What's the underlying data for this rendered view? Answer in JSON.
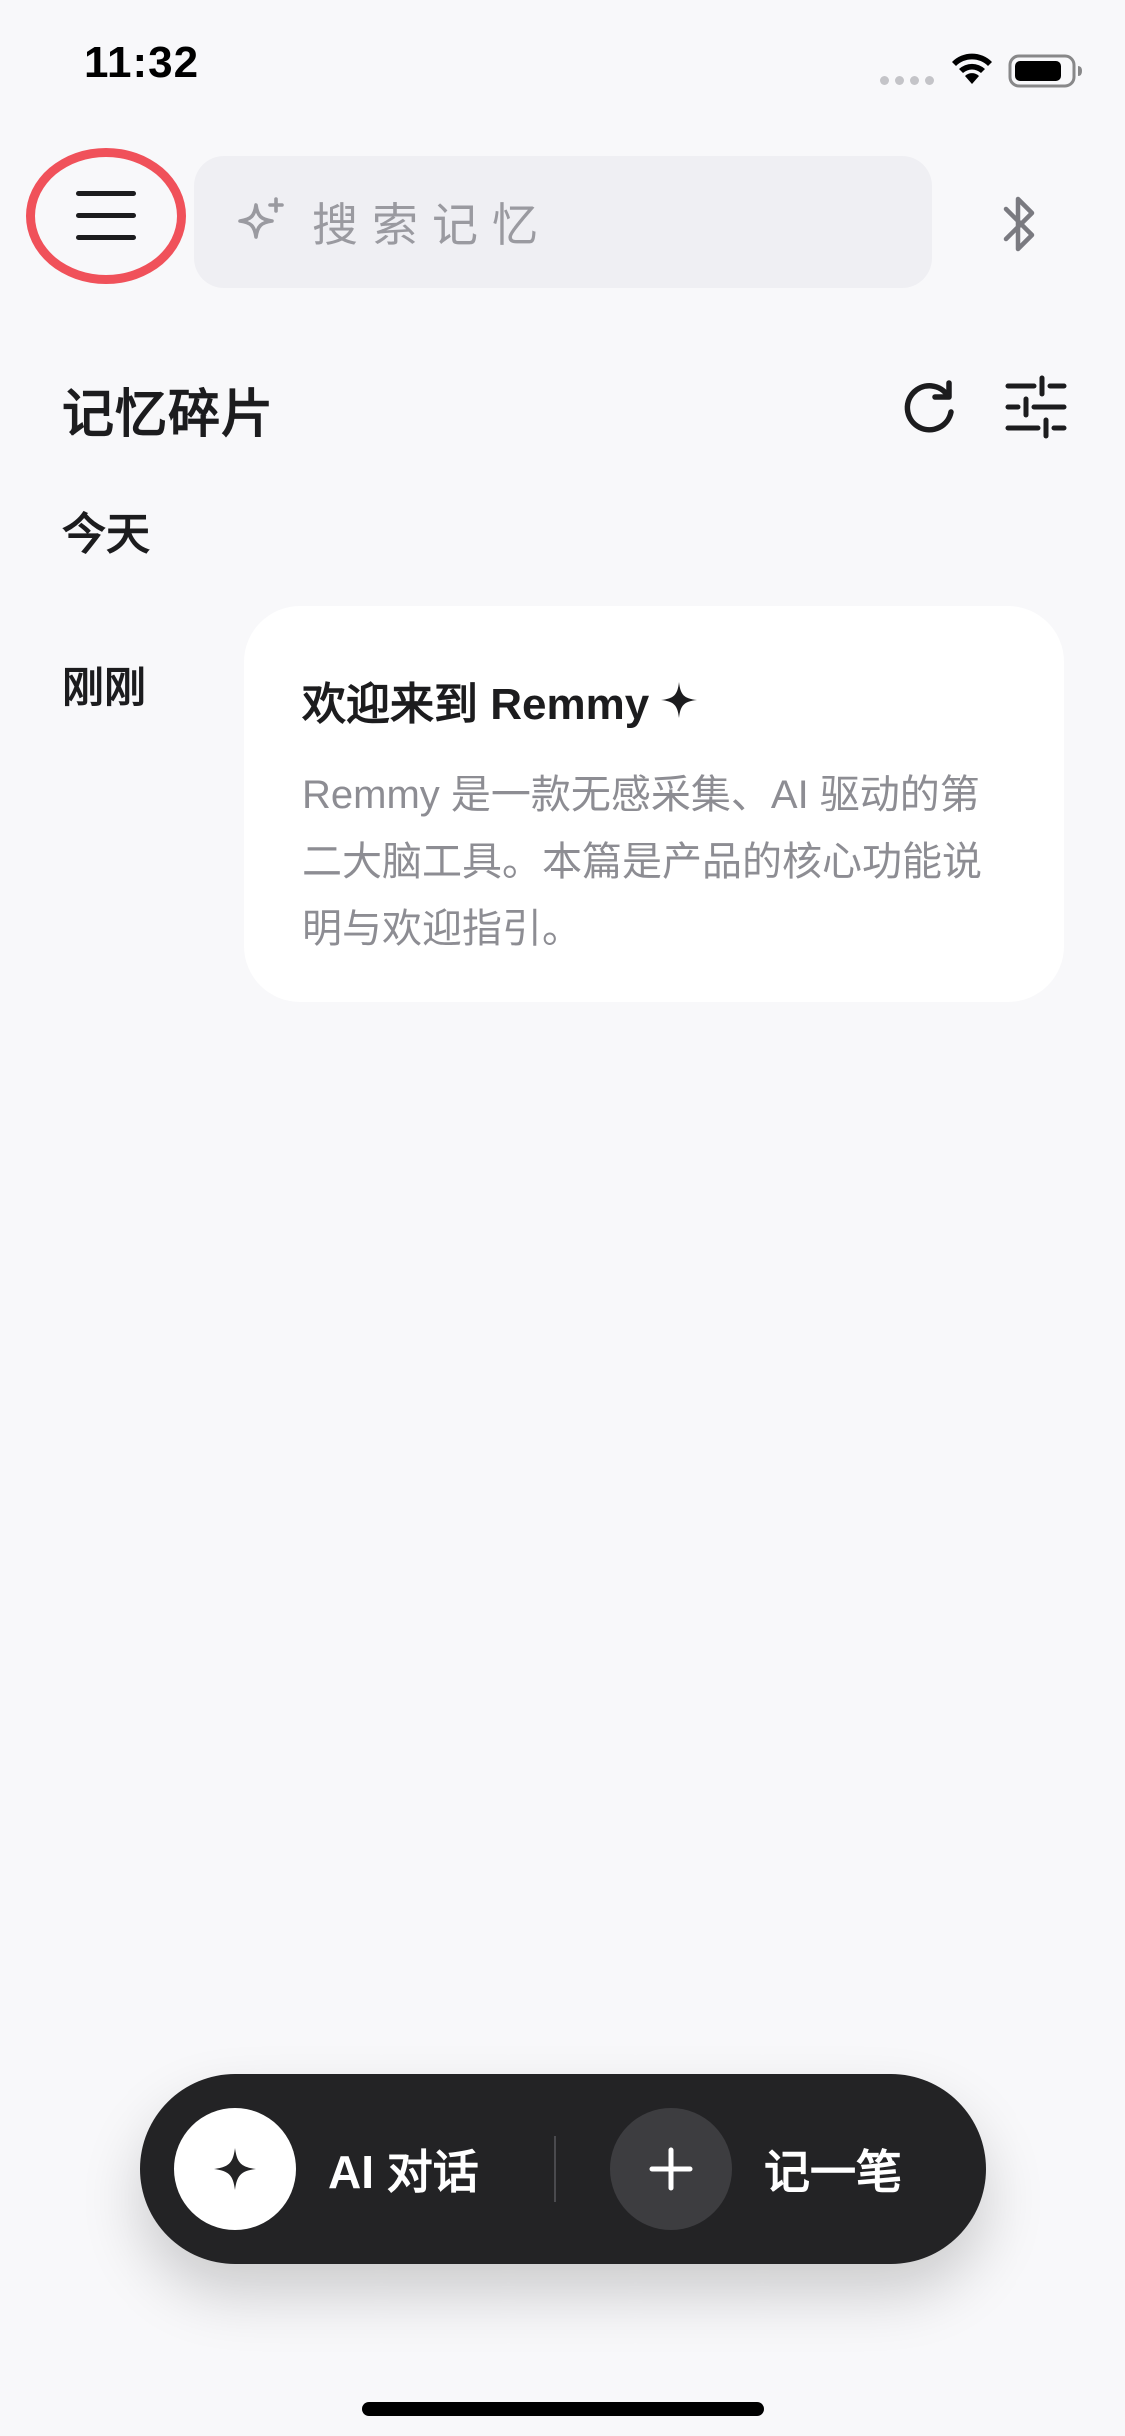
{
  "status_bar": {
    "time": "11:32"
  },
  "header": {
    "search_placeholder": "搜索记忆"
  },
  "section": {
    "title": "记忆碎片",
    "day_label": "今天"
  },
  "memory_item": {
    "time_label": "刚刚",
    "title": "欢迎来到 Remmy",
    "body": "Remmy 是一款无感采集、AI 驱动的第二大脑工具。本篇是产品的核心功能说明与欢迎指引。"
  },
  "action_bar": {
    "ai_chat_label": "AI 对话",
    "note_label": "记一笔"
  },
  "colors": {
    "background": "#f8f8fa",
    "highlight_ring": "#f0515a",
    "action_bar": "#232325",
    "secondary_text": "#8d8d93"
  },
  "icons": [
    "menu-icon",
    "sparkle-search-icon",
    "bluetooth-icon",
    "refresh-icon",
    "filter-icon",
    "sparkle-icon",
    "plus-icon",
    "wifi-icon",
    "battery-icon"
  ]
}
